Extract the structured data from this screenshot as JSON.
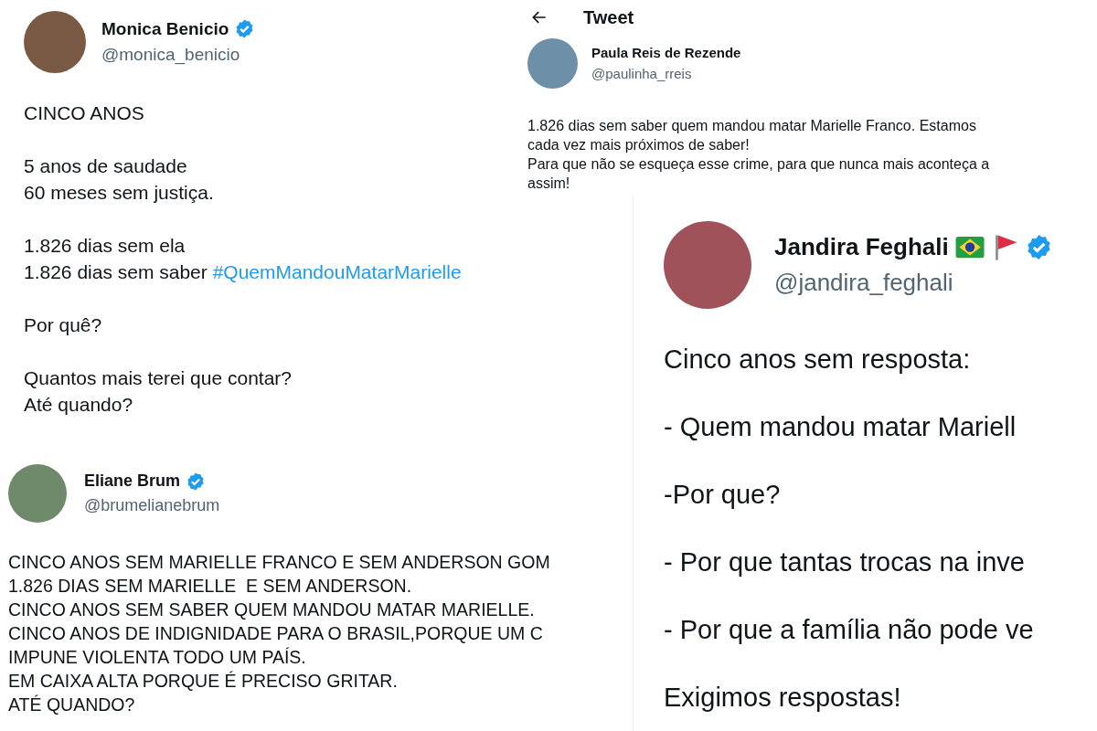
{
  "left_column": [
    {
      "name": "Monica Benicio",
      "badges": [
        {
          "kind": "verified"
        }
      ],
      "handle": "@monica_benicio",
      "paragraphs": [
        [
          {
            "text": "CINCO ANOS"
          }
        ],
        [
          {
            "text": "5 anos de saudade"
          },
          {
            "text": "60 meses sem justiça."
          }
        ],
        [
          {
            "text": "1.826 dias sem ela"
          },
          {
            "text": "1.826 dias sem saber ",
            "hashtag": "#QuemMandouMatarMarielle"
          }
        ],
        [
          {
            "text": "Por quê?"
          }
        ],
        [
          {
            "text": "Quantos mais terei que contar?"
          },
          {
            "text": "Até quando?"
          }
        ]
      ]
    },
    {
      "name": "Eliane Brum",
      "badges": [
        {
          "kind": "verified"
        }
      ],
      "handle": "@brumelianebrum",
      "paragraphs": [
        [
          {
            "text": "CINCO ANOS SEM MARIELLE FRANCO E SEM ANDERSON GOM"
          },
          {
            "text": "1.826 DIAS SEM MARIELLE  E SEM ANDERSON."
          },
          {
            "text": "CINCO ANOS SEM SABER QUEM MANDOU MATAR MARIELLE."
          },
          {
            "text": "CINCO ANOS DE INDIGNIDADE PARA O BRASIL,PORQUE UM C"
          },
          {
            "text": "IMPUNE VIOLENTA TODO UM PAÍS."
          },
          {
            "text": "EM CAIXA ALTA PORQUE É PRECISO GRITAR."
          },
          {
            "text": "ATÉ QUANDO?"
          }
        ]
      ]
    }
  ],
  "right_column": [
    {
      "header": {
        "title": "Tweet"
      },
      "name": "Paula Reis de Rezende",
      "handle": "@paulinha_rreis",
      "paragraphs": [
        [
          {
            "text": "1.826 dias sem saber quem mandou matar Marielle Franco. Estamos"
          },
          {
            "text": "cada vez mais próximos de saber!"
          },
          {
            "text": "Para que não se esqueça esse crime, para que nunca mais aconteça a"
          },
          {
            "text": "assim!"
          }
        ]
      ]
    },
    {
      "name": "Jandira Feghali",
      "badges": [
        {
          "kind": "flag-brazil"
        },
        {
          "kind": "flag-red"
        },
        {
          "kind": "verified"
        }
      ],
      "handle": "@jandira_feghali",
      "paragraphs": [
        [
          {
            "text": "Cinco anos sem resposta:"
          }
        ],
        [
          {
            "text": "- Quem mandou matar Mariell"
          }
        ],
        [
          {
            "text": "-Por que?"
          }
        ],
        [
          {
            "text": "- Por que tantas trocas na inve"
          }
        ],
        [
          {
            "text": "- Por que a família não pode ve"
          }
        ],
        [
          {
            "text": "Exigimos respostas!"
          }
        ]
      ]
    }
  ]
}
